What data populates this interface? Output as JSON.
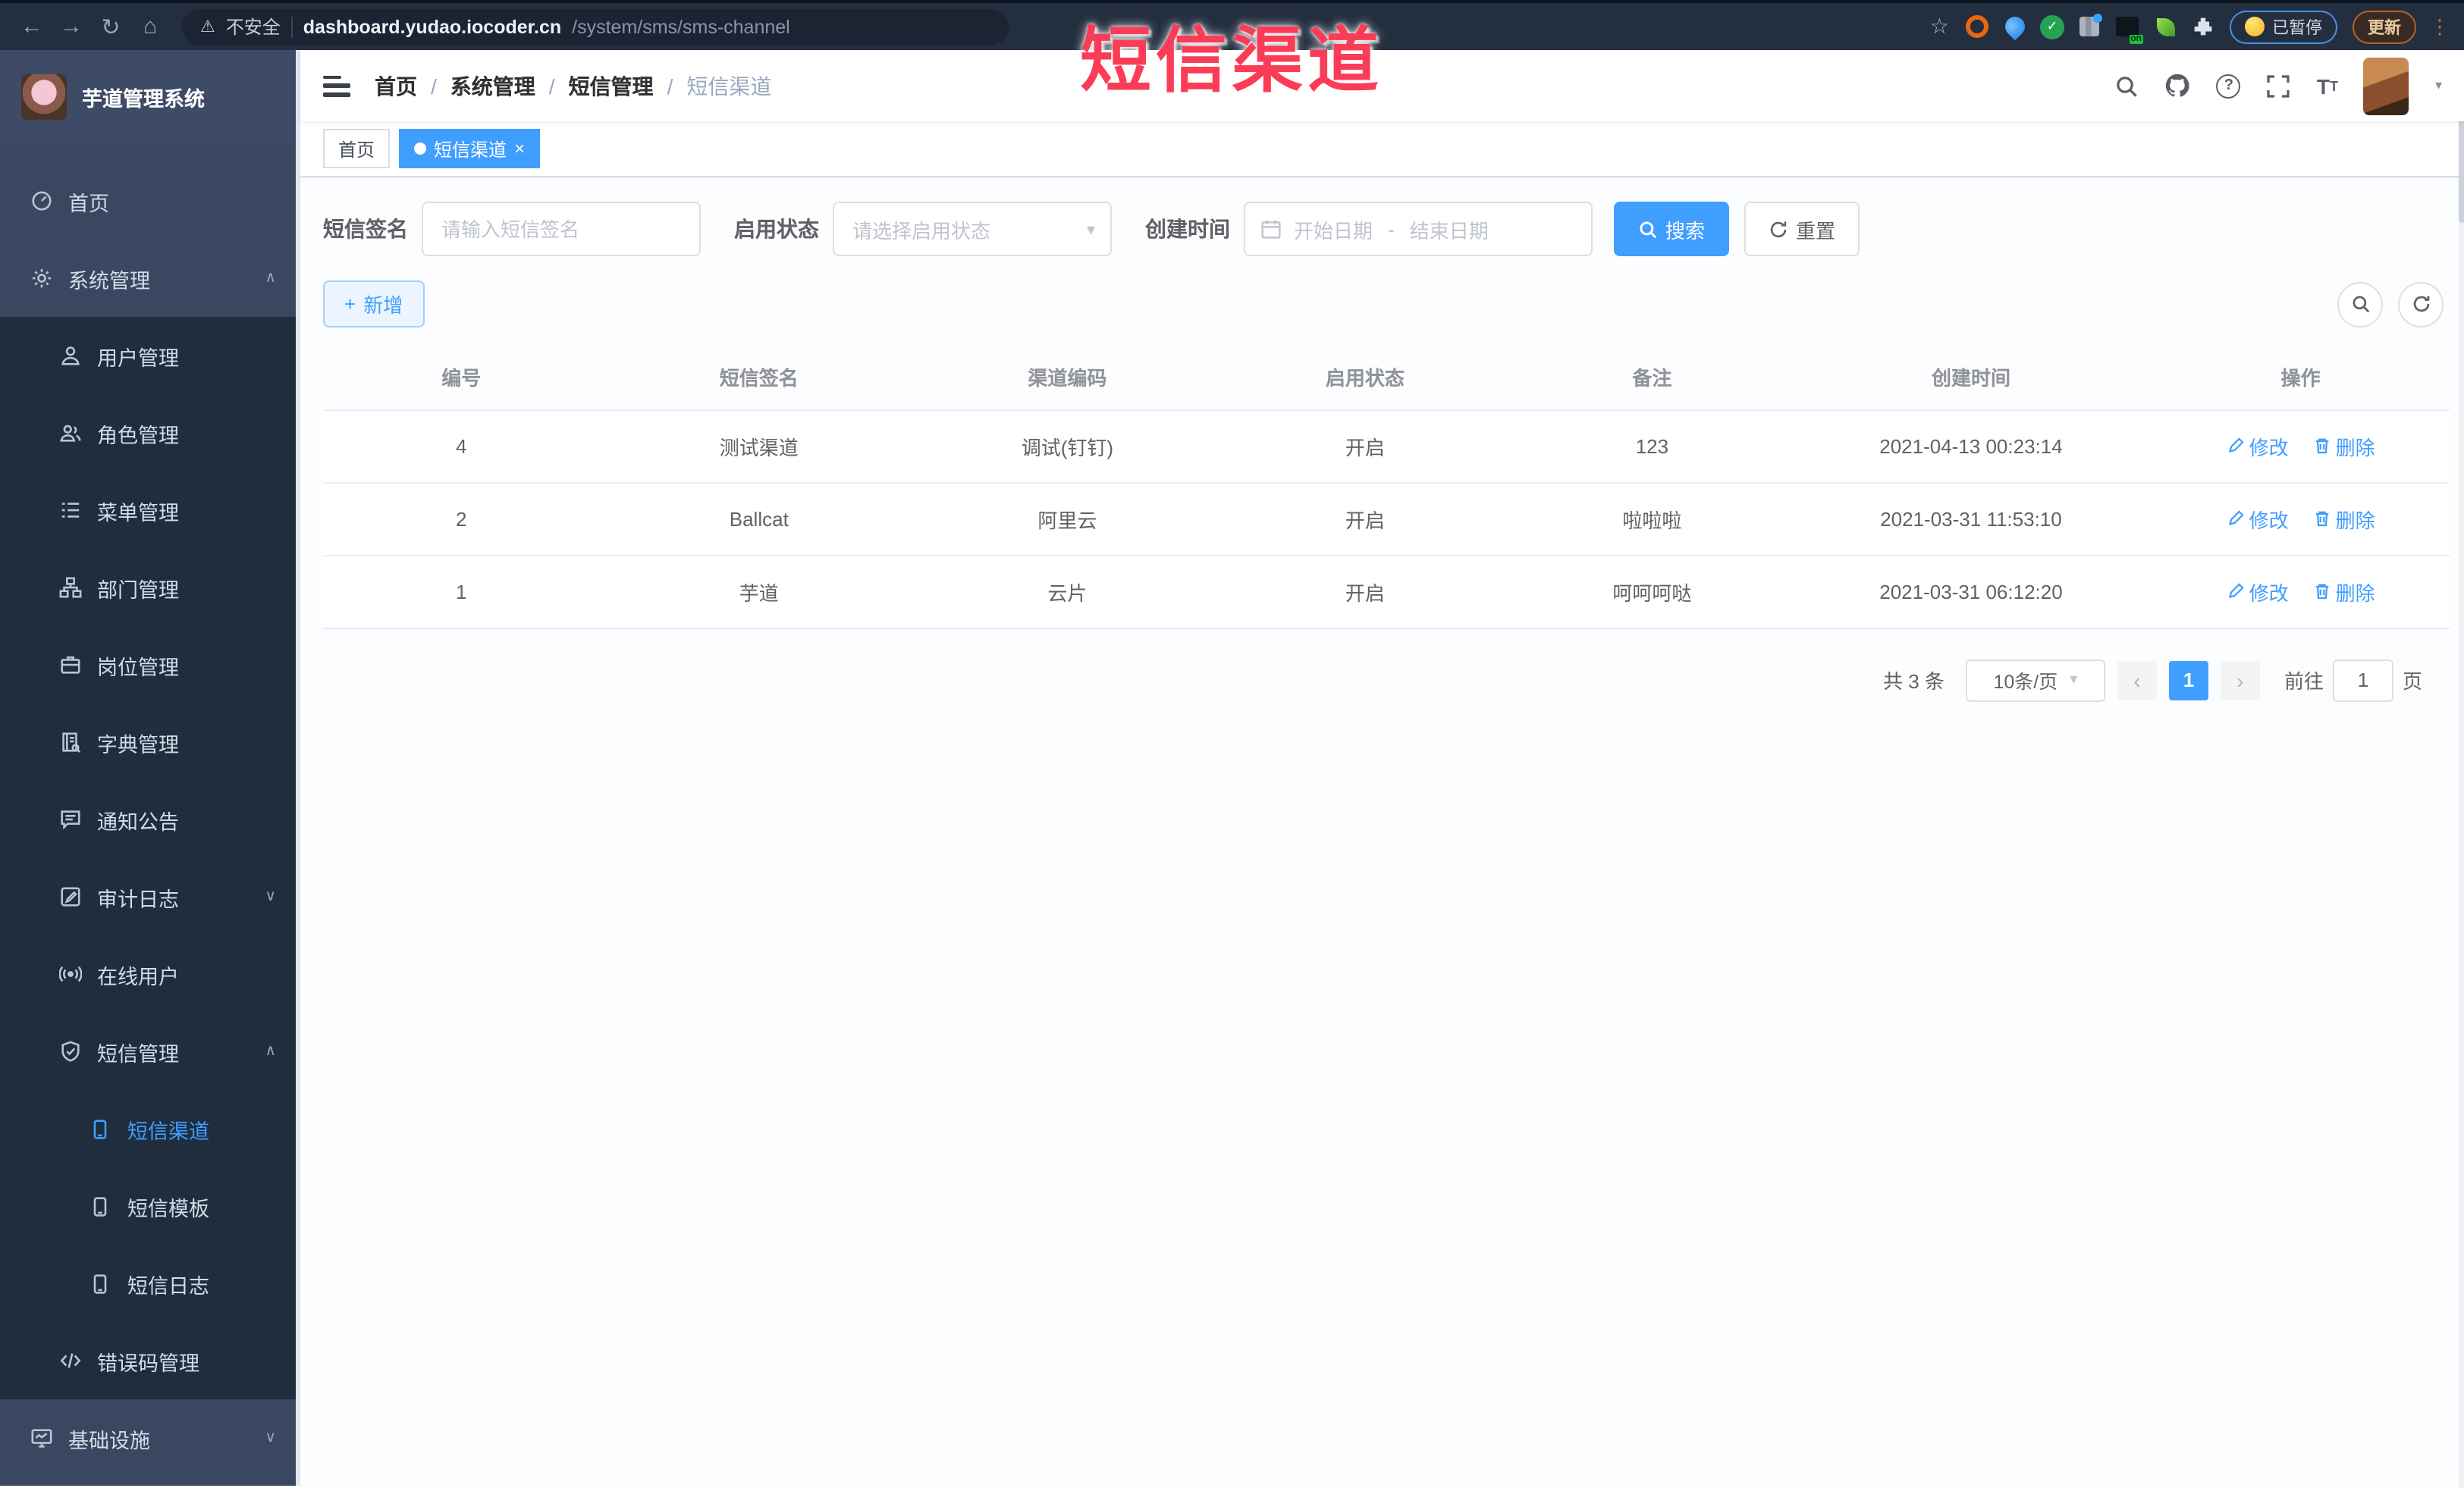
{
  "browser": {
    "security_label": "不安全",
    "url_host": "dashboard.yudao.iocoder.cn",
    "url_path": "/system/sms/sms-channel",
    "paused_label": "已暂停",
    "update_label": "更新"
  },
  "icons": {
    "back": "←",
    "forward": "→",
    "reload": "↻",
    "home": "⌂",
    "warning": "⚠",
    "star": "☆",
    "puzzle": "⧩",
    "ellipsis": "⋮",
    "question": "?",
    "caret_down": "▾",
    "chevron_up": "∧",
    "chevron_down": "∨",
    "prev": "‹",
    "next": "›",
    "close": "×",
    "plus": "+",
    "dot": "",
    "slash": "/"
  },
  "overlay": {
    "title": "短信渠道",
    "color": "#fb3c57"
  },
  "sidebar": {
    "app_title": "芋道管理系统",
    "items": [
      {
        "label": "首页"
      },
      {
        "label": "系统管理"
      },
      {
        "label": "用户管理"
      },
      {
        "label": "角色管理"
      },
      {
        "label": "菜单管理"
      },
      {
        "label": "部门管理"
      },
      {
        "label": "岗位管理"
      },
      {
        "label": "字典管理"
      },
      {
        "label": "通知公告"
      },
      {
        "label": "审计日志"
      },
      {
        "label": "在线用户"
      },
      {
        "label": "短信管理"
      },
      {
        "label": "短信渠道"
      },
      {
        "label": "短信模板"
      },
      {
        "label": "短信日志"
      },
      {
        "label": "错误码管理"
      },
      {
        "label": "基础设施"
      }
    ],
    "active_item": "短信渠道",
    "active_color": "#409eff"
  },
  "breadcrumb": {
    "items": [
      "首页",
      "系统管理",
      "短信管理",
      "短信渠道"
    ]
  },
  "tabs": [
    {
      "label": "首页"
    },
    {
      "label": "短信渠道"
    }
  ],
  "filters": {
    "sign_label": "短信签名",
    "sign_placeholder": "请输入短信签名",
    "status_label": "启用状态",
    "status_placeholder": "请选择启用状态",
    "date_label": "创建时间",
    "date_start_placeholder": "开始日期",
    "date_separator": "-",
    "date_end_placeholder": "结束日期",
    "search_label": "搜索",
    "reset_label": "重置"
  },
  "toolbar": {
    "add_label": "新增"
  },
  "table": {
    "headers": [
      "编号",
      "短信签名",
      "渠道编码",
      "启用状态",
      "备注",
      "创建时间",
      "操作"
    ],
    "rows": [
      {
        "id": "4",
        "sign": "测试渠道",
        "code": "调试(钉钉)",
        "status": "开启",
        "remark": "123",
        "created": "2021-04-13 00:23:14"
      },
      {
        "id": "2",
        "sign": "Ballcat",
        "code": "阿里云",
        "status": "开启",
        "remark": "啦啦啦",
        "created": "2021-03-31 11:53:10"
      },
      {
        "id": "1",
        "sign": "芋道",
        "code": "云片",
        "status": "开启",
        "remark": "呵呵呵哒",
        "created": "2021-03-31 06:12:20"
      }
    ],
    "edit_label": "修改",
    "delete_label": "删除"
  },
  "pagination": {
    "total_label": "共 3 条",
    "page_size": "10条/页",
    "current_page": "1",
    "goto_label": "前往",
    "goto_value": "1",
    "page_unit": "页"
  }
}
